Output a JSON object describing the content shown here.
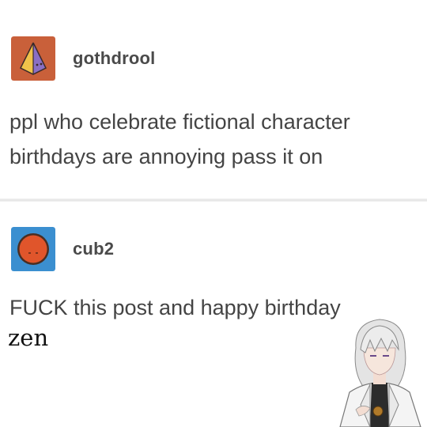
{
  "posts": [
    {
      "username": "gothdrool",
      "text": "ppl who celebrate fictional character birthdays are annoying pass it on",
      "avatar_icon": "pyramid-icon",
      "avatar_color": "#c9603a"
    },
    {
      "username": "cub2",
      "text": "FUCK this post and happy birthday",
      "avatar_icon": "orange-circle-face-icon",
      "avatar_color": "#3b8fd0"
    }
  ],
  "caption": "zen",
  "sticker_icon": "anime-character-sticker-icon"
}
